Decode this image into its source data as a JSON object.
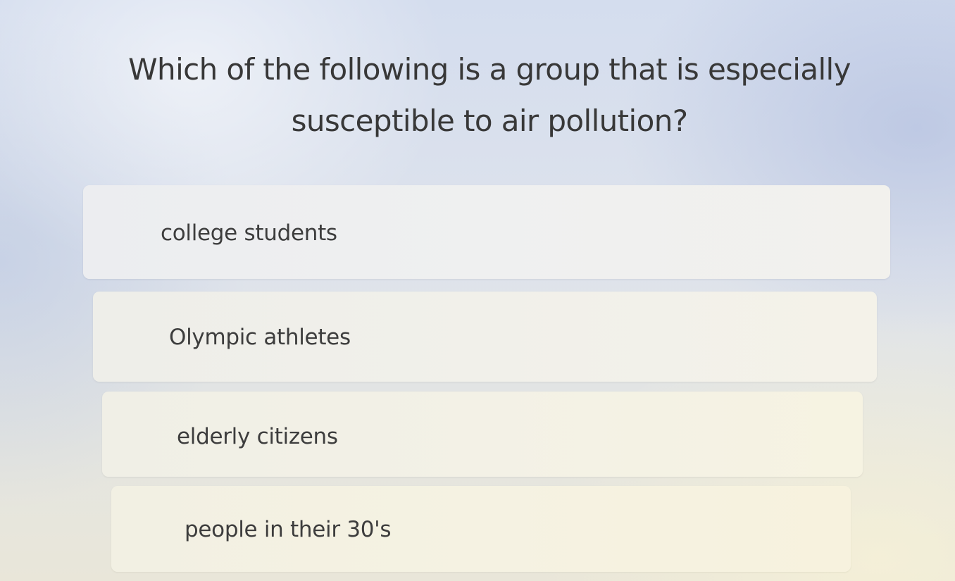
{
  "question": {
    "line1": "Which of the following is a group that is especially",
    "line2": "susceptible to air pollution?"
  },
  "options": [
    {
      "label": "college students"
    },
    {
      "label": "Olympic athletes"
    },
    {
      "label": "elderly citizens"
    },
    {
      "label": "people in their 30's"
    }
  ]
}
